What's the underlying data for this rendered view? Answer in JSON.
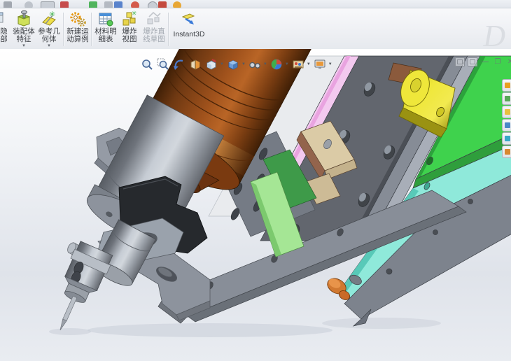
{
  "window": {
    "watermark": "D"
  },
  "ribbon": {
    "buttons": [
      {
        "id": "show-hidden-components",
        "label": "显示隐藏零部件",
        "partial": true
      },
      {
        "id": "assembly-features",
        "label": "装配体特征",
        "arrow": "▾"
      },
      {
        "id": "reference-geometry",
        "label": "参考几何体",
        "arrow": "▾"
      },
      {
        "id": "new-motion-study",
        "label": "新建运动算例"
      },
      {
        "id": "bill-of-materials",
        "label": "材料明细表"
      },
      {
        "id": "exploded-view",
        "label": "爆炸视图"
      },
      {
        "id": "explode-line-sketch",
        "label": "爆炸直线草图",
        "disabled": true
      },
      {
        "id": "instant3d",
        "label": "Instant3D"
      }
    ]
  },
  "viewport": {
    "hud_tools": [
      "zoom-to-fit",
      "zoom-to-area",
      "previous-view",
      "section-view",
      "view-orientation",
      "display-style",
      "hide-show-items",
      "edit-appearance",
      "apply-scene",
      "view-settings"
    ],
    "window_controls": {
      "minimize": "—",
      "restore": "❐",
      "close": "✕"
    },
    "task_pane_tabs": [
      "solidworks-resources",
      "design-library",
      "file-explorer",
      "view-palette",
      "appearances-scenes",
      "custom-properties"
    ]
  },
  "model": {
    "description": "3D assembly: dispensing spindle head mounted on diagonal slide plate stack",
    "parts": [
      {
        "name": "motor-body",
        "color": "#9a4f1a"
      },
      {
        "name": "motor-dark",
        "color": "#5a2c0e"
      },
      {
        "name": "motor-highlight",
        "color": "#c9803a"
      },
      {
        "name": "spindle",
        "color": "#a7adb6"
      },
      {
        "name": "clamp",
        "color": "#26292d"
      },
      {
        "name": "bracket",
        "color": "#959ba5"
      },
      {
        "name": "white-plate",
        "color": "#e9ebee"
      },
      {
        "name": "pink-rail",
        "color": "#f3c9ef"
      },
      {
        "name": "pink-stripe",
        "color": "#e9a3e0"
      },
      {
        "name": "dark-plate",
        "color": "#62666e"
      },
      {
        "name": "mid-gray",
        "color": "#868c96"
      },
      {
        "name": "sliver-gray",
        "color": "#a8aeb8"
      },
      {
        "name": "green-plate",
        "color": "#3fd24d"
      },
      {
        "name": "green-edge",
        "color": "#2ca23c"
      },
      {
        "name": "cyan-rail",
        "color": "#8fe9da"
      },
      {
        "name": "cyan-edge",
        "color": "#58c9b8"
      },
      {
        "name": "right-face",
        "color": "#7d838d"
      },
      {
        "name": "frame-gray",
        "color": "#888e98"
      },
      {
        "name": "plate-holes",
        "color": "#757b85"
      },
      {
        "name": "rail-green-dark",
        "color": "#3e9a49"
      },
      {
        "name": "slide-green",
        "color": "#a5e695"
      },
      {
        "name": "yellow-bearing",
        "color": "#efe73a"
      },
      {
        "name": "tan-block",
        "color": "#dbcba6"
      },
      {
        "name": "tan-side",
        "color": "#93644c"
      },
      {
        "name": "copper-fitting",
        "color": "#d07830"
      },
      {
        "name": "needle",
        "color": "#b9bfc7"
      }
    ]
  }
}
